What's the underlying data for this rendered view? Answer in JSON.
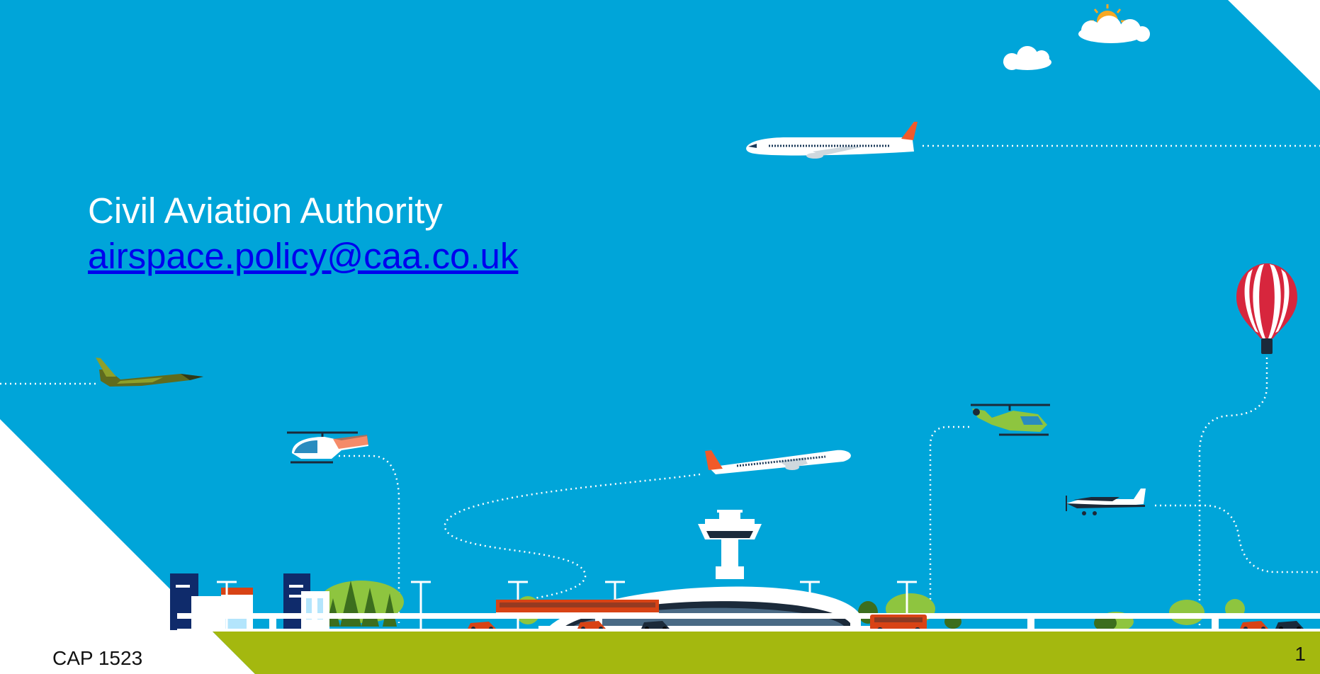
{
  "slide": {
    "title": "Civil Aviation Authority",
    "email": "airspace.policy@caa.co.uk",
    "doc_ref": "CAP 1523",
    "page_number": "1"
  },
  "colors": {
    "sky": "#00a5d9",
    "ground": "#a4b80f",
    "white": "#ffffff",
    "link": "#0000ee",
    "accent_orange": "#f15a29",
    "balloon_red": "#d7263d",
    "text_dark": "#111111"
  },
  "illustration": {
    "icons": [
      "sun-icon",
      "cloud-icon",
      "airliner-icon",
      "fighter-jet-icon",
      "helicopter-icon",
      "hot-air-balloon-icon",
      "light-aircraft-icon",
      "control-tower-icon",
      "airport-terminal-icon",
      "train-icon",
      "bus-icon",
      "car-icon",
      "tree-icon",
      "building-icon",
      "street-lamp-icon"
    ]
  }
}
